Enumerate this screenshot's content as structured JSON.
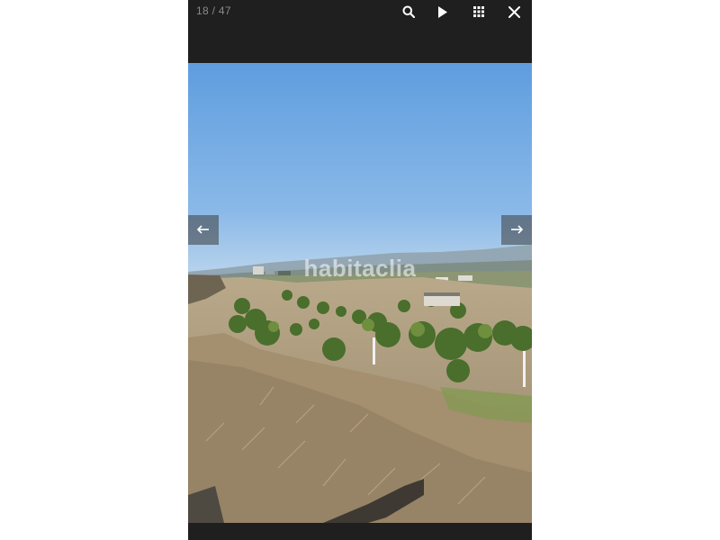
{
  "viewer": {
    "counter": "18 / 47",
    "watermark": "habitaclia",
    "toolbar": {
      "search_icon": "search-icon",
      "play_icon": "play-icon",
      "grid_icon": "grid-icon",
      "close_icon": "close-icon"
    },
    "nav": {
      "prev_icon": "arrow-left-icon",
      "next_icon": "arrow-right-icon"
    }
  },
  "colors": {
    "viewer_bg": "#1f1f1f",
    "counter_text": "#8a8a8a",
    "icon": "#ffffff",
    "sky": "#6fa6e0"
  }
}
